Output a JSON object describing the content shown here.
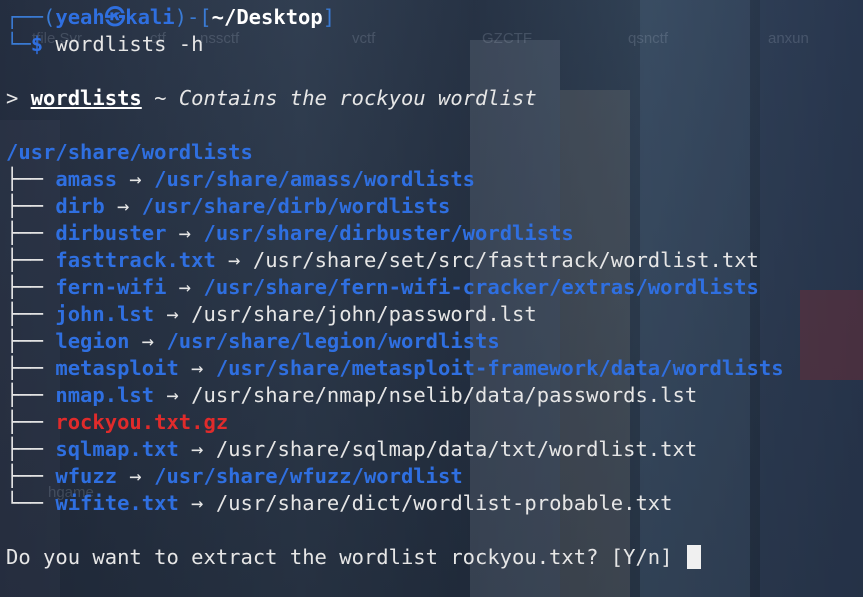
{
  "prompt": {
    "user": "yeah",
    "at": "㉿",
    "host": "kali",
    "cwd": "~/Desktop",
    "command": "wordlists -h"
  },
  "background_labels": [
    "tfile Svr",
    "ctf",
    "nssctf",
    "vctf",
    "GZCTF",
    "qsnctf",
    "anxun",
    "hgame"
  ],
  "header": {
    "marker": ">",
    "tool": "wordlists",
    "separator": "~",
    "description": "Contains the rockyou wordlist"
  },
  "root": "/usr/share/wordlists",
  "arrow": "→",
  "tree_branch": "├──",
  "tree_last": "└──",
  "entries": [
    {
      "name": "amass",
      "target": "/usr/share/amass/wordlists",
      "kind": "dir"
    },
    {
      "name": "dirb",
      "target": "/usr/share/dirb/wordlists",
      "kind": "dir"
    },
    {
      "name": "dirbuster",
      "target": "/usr/share/dirbuster/wordlists",
      "kind": "dir"
    },
    {
      "name": "fasttrack.txt",
      "target": "/usr/share/set/src/fasttrack/wordlist.txt",
      "kind": "file"
    },
    {
      "name": "fern-wifi",
      "target": "/usr/share/fern-wifi-cracker/extras/wordlists",
      "kind": "dir"
    },
    {
      "name": "john.lst",
      "target": "/usr/share/john/password.lst",
      "kind": "file"
    },
    {
      "name": "legion",
      "target": "/usr/share/legion/wordlists",
      "kind": "dir"
    },
    {
      "name": "metasploit",
      "target": "/usr/share/metasploit-framework/data/wordlists",
      "kind": "dir"
    },
    {
      "name": "nmap.lst",
      "target": "/usr/share/nmap/nselib/data/passwords.lst",
      "kind": "file"
    },
    {
      "name": "rockyou.txt.gz",
      "target": "",
      "kind": "archive"
    },
    {
      "name": "sqlmap.txt",
      "target": "/usr/share/sqlmap/data/txt/wordlist.txt",
      "kind": "file"
    },
    {
      "name": "wfuzz",
      "target": "/usr/share/wfuzz/wordlist",
      "kind": "dir"
    },
    {
      "name": "wifite.txt",
      "target": "/usr/share/dict/wordlist-probable.txt",
      "kind": "file"
    }
  ],
  "question": "Do you want to extract the wordlist rockyou.txt? [Y/n]",
  "colors": {
    "dir_blue": "#2f6fe0",
    "archive_red": "#e02b2b",
    "text": "#e6e6e6"
  }
}
